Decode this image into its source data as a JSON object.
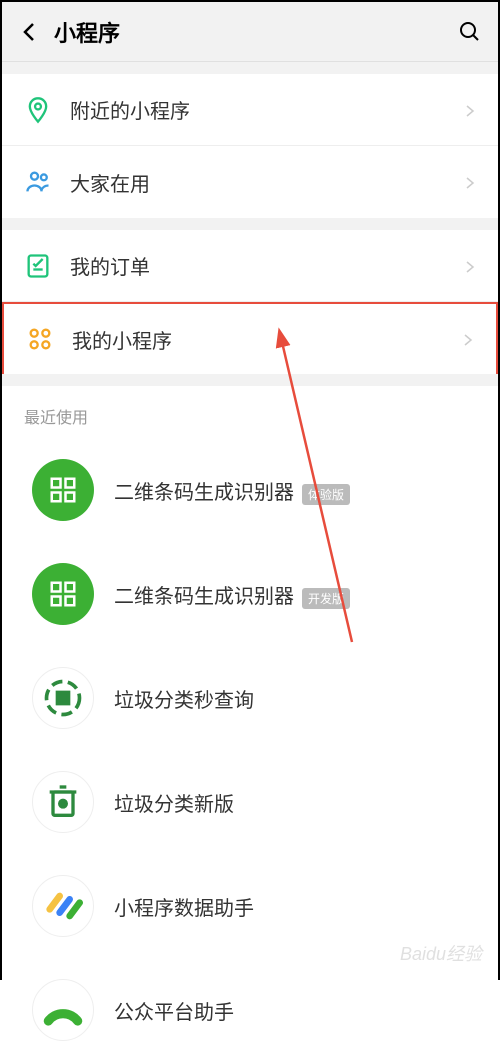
{
  "header": {
    "title": "小程序"
  },
  "group1": {
    "items": [
      {
        "label": "附近的小程序",
        "icon": "location"
      },
      {
        "label": "大家在用",
        "icon": "people"
      }
    ]
  },
  "group2": {
    "items": [
      {
        "label": "我的订单",
        "icon": "order"
      },
      {
        "label": "我的小程序",
        "icon": "grid"
      }
    ]
  },
  "recent": {
    "header": "最近使用",
    "items": [
      {
        "label": "二维条码生成识别器",
        "badge": "体验版",
        "icon_bg": "#3cb034",
        "icon": "qr-round"
      },
      {
        "label": "二维条码生成识别器",
        "badge": "开发版",
        "icon_bg": "#3cb034",
        "icon": "qr-round"
      },
      {
        "label": "垃圾分类秒查询",
        "badge": "",
        "icon_bg": "#fff",
        "icon": "recycle"
      },
      {
        "label": "垃圾分类新版",
        "badge": "",
        "icon_bg": "#fff",
        "icon": "trash"
      },
      {
        "label": "小程序数据助手",
        "badge": "",
        "icon_bg": "#fff",
        "icon": "stripes"
      },
      {
        "label": "公众平台助手",
        "badge": "",
        "icon_bg": "#fff",
        "icon": "arc"
      }
    ]
  },
  "watermark": "Baidu经验"
}
